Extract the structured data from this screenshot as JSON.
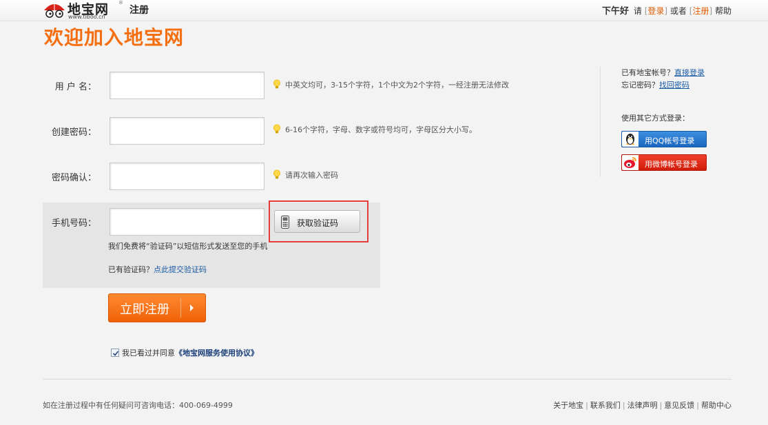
{
  "header": {
    "logo_text": "地宝网",
    "logo_reg": "®",
    "logo_url": "www.tiboo.cn",
    "section": "注册",
    "greeting": "下午好",
    "please": "请",
    "login_label": "登录",
    "or": "或者",
    "register_label": "注册",
    "help": "帮助",
    "bracket_open": "[",
    "bracket_close": "]"
  },
  "page": {
    "title": "欢迎加入地宝网"
  },
  "form": {
    "username": {
      "label": "用 户 名：",
      "value": "",
      "hint": "中英文均可，3-15个字符，1个中文为2个字符，一经注册无法修改"
    },
    "password": {
      "label": "创建密码：",
      "value": "",
      "hint": "6-16个字符，字母、数字或符号均可，字母区分大小写。"
    },
    "confirm": {
      "label": "密码确认：",
      "value": "",
      "hint": "请再次输入密码"
    },
    "phone": {
      "label": "手机号码：",
      "value": ""
    },
    "sms_button": "获取验证码",
    "sms_note": "我们免费将“验证码”以短信形式发送至您的手机",
    "have_code": "已有验证码？",
    "have_code_link": "点此提交验证码",
    "submit": "立即注册",
    "agree_prefix": "我已看过并同意",
    "agree_link": "《地宝网服务使用协议》",
    "agree_checked": true
  },
  "sidebar": {
    "has_account": "已有地宝帐号？",
    "direct_login": "直接登录",
    "forgot": "忘记密码？",
    "retrieve": "找回密码",
    "other_login": "使用其它方式登录：",
    "qq_login": "用QQ帐号登录",
    "weibo_login": "用微博帐号登录"
  },
  "footer": {
    "contact": "如在注册过程中有任何疑问可咨询电话：400-069-4999",
    "links": [
      "关于地宝",
      "联系我们",
      "法律声明",
      "意见反馈",
      "帮助中心"
    ]
  },
  "colors": {
    "accent_orange": "#f56f12",
    "link_blue": "#1a5aa5",
    "highlight_red": "#e43a3a",
    "qq_blue": "#1c66c0",
    "weibo_red": "#d21c0a"
  },
  "icons": [
    "umbrella-logo-icon",
    "lightbulb-icon",
    "mobile-phone-icon",
    "arrow-right-icon",
    "checkbox-check-icon",
    "qq-penguin-icon",
    "weibo-icon"
  ]
}
